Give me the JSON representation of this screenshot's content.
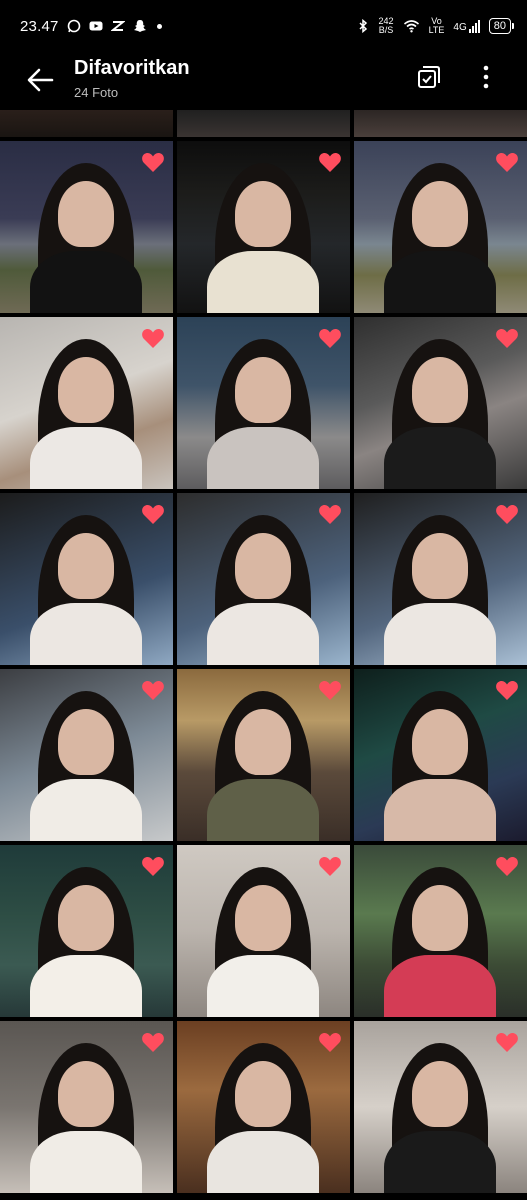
{
  "status_bar": {
    "time": "23.47",
    "network_speed_value": "242",
    "network_speed_unit": "B/S",
    "volte_top": "Vo",
    "volte_bottom": "LTE",
    "signal_label": "4G",
    "battery": "80"
  },
  "app_bar": {
    "title": "Difavoritkan",
    "subtitle": "24 Foto"
  },
  "colors": {
    "background": "#000000",
    "heart": "#ff4d5e",
    "subtitle": "#bdbdbd"
  },
  "icons": {
    "back": "arrow-left-icon",
    "select": "select-all-icon",
    "more": "more-vertical-icon",
    "favorite": "heart-icon"
  },
  "grid": {
    "columns": 3,
    "favorited_visible": 18,
    "photos": [
      {
        "bg": "linear-gradient(#2a1f1a,#1a1512)",
        "fav": false
      },
      {
        "bg": "linear-gradient(#202020,#3a3432)",
        "fav": false
      },
      {
        "bg": "linear-gradient(#2c2624,#4a3f3b)",
        "fav": false
      },
      {
        "bg": "linear-gradient(180deg,#2a2d44 0%,#3a3c55 45%,#6b6f7a 60%,#4f5a3a 75%,#6f6a55 100%)",
        "fav": true,
        "p": "#121212"
      },
      {
        "bg": "linear-gradient(180deg,#0d0d0d 0%,#1c1c1a 30%,#24272a 60%,#121212 100%)",
        "fav": true,
        "p": "#e8e1d1"
      },
      {
        "bg": "linear-gradient(180deg,#3b4258 0%,#5a6071 45%,#7a8690 60%,#6e6d46 78%,#8f8a76 100%)",
        "fav": true,
        "p": "#141414"
      },
      {
        "bg": "linear-gradient(160deg,#b8b5b1 0%,#d7d3cd 45%,#a78f7b 70%,#c9c3bd 100%)",
        "fav": true,
        "p": "#ece8e4"
      },
      {
        "bg": "linear-gradient(180deg,#2c4257 0%,#3f5469 40%,#8b8a8a 70%,#5d5c5e 100%)",
        "fav": true,
        "p": "#c9c3bf"
      },
      {
        "bg": "linear-gradient(160deg,#2f2f2f 0%,#5a5a5a 40%,#8a8482 60%,#3a3a3a 100%)",
        "fav": true,
        "p": "#1b1b1b"
      },
      {
        "bg": "linear-gradient(160deg,#1c1c1c 0%,#3a4f6a 60%,#8fa8c2 100%)",
        "fav": true,
        "p": "#ece7e2"
      },
      {
        "bg": "linear-gradient(160deg,#2d2d2d 0%,#4d627c 60%,#9ab4cc 100%)",
        "fav": true,
        "p": "#ece7e2"
      },
      {
        "bg": "linear-gradient(160deg,#1f1f1f 0%,#54677f 60%,#aac0d5 100%)",
        "fav": true,
        "p": "#ece7e2"
      },
      {
        "bg": "linear-gradient(160deg,#3c3e42 0%,#7d8a96 50%,#c7c9ca 100%)",
        "fav": true,
        "p": "#f0ece6"
      },
      {
        "bg": "linear-gradient(180deg,#8b6a3e 0%,#b89a66 30%,#5b4a3b 60%,#3a2e27 100%)",
        "fav": true,
        "p": "#5f6048"
      },
      {
        "bg": "linear-gradient(160deg,#0e1f1c 0%,#1f4a44 40%,#2b3a55 70%,#1b1b2e 100%)",
        "fav": true,
        "p": "#d7b9a8"
      },
      {
        "bg": "linear-gradient(180deg,#1f3b3a 0%,#2d4d44 40%,#3b5a52 70%,#263838 100%)",
        "fav": true,
        "p": "#f3efe8"
      },
      {
        "bg": "linear-gradient(180deg,#cfc9c2 0%,#bbb4ad 50%,#8d8680 100%)",
        "fav": true,
        "p": "#f2efea"
      },
      {
        "bg": "linear-gradient(180deg,#3a4a3a 0%,#5a7a4f 40%,#3c4b35 70%,#2a2f29 100%)",
        "fav": true,
        "p": "#d43c55"
      },
      {
        "bg": "linear-gradient(180deg,#5a5652 0%,#7a7570 50%,#c6bfb8 100%)",
        "fav": true,
        "p": "#f0ece6"
      },
      {
        "bg": "linear-gradient(180deg,#6b3f22 0%,#9b6a3f 40%,#4a2f1f 100%)",
        "fav": true,
        "p": "#e9e5e0"
      },
      {
        "bg": "linear-gradient(180deg,#a9a39d 0%,#d6d0c9 50%,#8b847e 100%)",
        "fav": true,
        "p": "#1a1a1a"
      }
    ]
  }
}
